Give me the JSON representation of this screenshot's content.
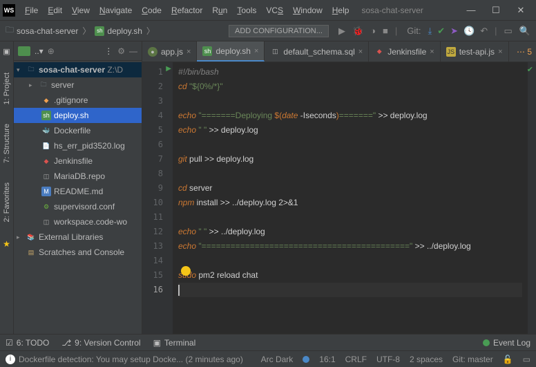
{
  "menu": {
    "file": "File",
    "edit": "Edit",
    "view": "View",
    "navigate": "Navigate",
    "code": "Code",
    "refactor": "Refactor",
    "run": "Run",
    "tools": "Tools",
    "vcs": "VCS",
    "window": "Window",
    "help": "Help"
  },
  "project_name": "sosa-chat-server",
  "breadcrumb": {
    "root": "sosa-chat-server",
    "file": "deploy.sh"
  },
  "config_placeholder": "ADD CONFIGURATION...",
  "git_label": "Git:",
  "left_tabs": {
    "project": "1: Project",
    "structure": "7: Structure",
    "favorites": "2: Favorites"
  },
  "tree": {
    "root": "sosa-chat-server",
    "root_suffix": "Z:\\D",
    "server": "server",
    "gitignore": ".gitignore",
    "deploy": "deploy.sh",
    "dockerfile": "Dockerfile",
    "hserr": "hs_err_pid3520.log",
    "jenkins": "Jenkinsfile",
    "mariadb": "MariaDB.repo",
    "readme": "README.md",
    "supervisord": "supervisord.conf",
    "workspace": "workspace.code-wo",
    "extlib": "External Libraries",
    "scratches": "Scratches and Console"
  },
  "tabs": [
    {
      "label": "app.js"
    },
    {
      "label": "deploy.sh",
      "active": true
    },
    {
      "label": "default_schema.sql"
    },
    {
      "label": "Jenkinsfile"
    },
    {
      "label": "test-api.js"
    }
  ],
  "more_tabs_count": "5",
  "code": {
    "l1": "#!/bin/bash",
    "l2a": "cd",
    "l2b": " \"${0%/*}\"",
    "l4a": "echo",
    "l4b": " \"=======Deploying ",
    "l4c": "$(",
    "l4d": "date",
    "l4e": " -Iseconds",
    "l4f": ")",
    "l4g": "=======\" ",
    "l4h": ">> deploy.log",
    "l5a": "echo",
    "l5b": " \" \" ",
    "l5c": ">> deploy.log",
    "l7a": "git",
    "l7b": " pull >> deploy.log",
    "l9a": "cd",
    "l9b": " server",
    "l10a": "npm",
    "l10b": " install >> ../deploy.log 2>&1",
    "l12a": "echo",
    "l12b": " \" \" ",
    "l12c": ">> ../deploy.log",
    "l13a": "echo",
    "l13b": " \"===========================================\" ",
    "l13c": ">> ../deploy.log",
    "l15a": "sudo",
    "l15b": " pm2 reload chat"
  },
  "line_nums": [
    "1",
    "2",
    "3",
    "4",
    "5",
    "6",
    "7",
    "8",
    "9",
    "10",
    "11",
    "12",
    "13",
    "14",
    "15",
    "16"
  ],
  "bottom": {
    "todo": "6: TODO",
    "vcs": "9: Version Control",
    "terminal": "Terminal",
    "eventlog": "Event Log"
  },
  "status": {
    "notif": "Dockerfile detection: You may setup Docke... (2 minutes ago)",
    "theme": "Arc Dark",
    "pos": "16:1",
    "eol": "CRLF",
    "enc": "UTF-8",
    "indent": "2 spaces",
    "branch": "Git: master"
  }
}
